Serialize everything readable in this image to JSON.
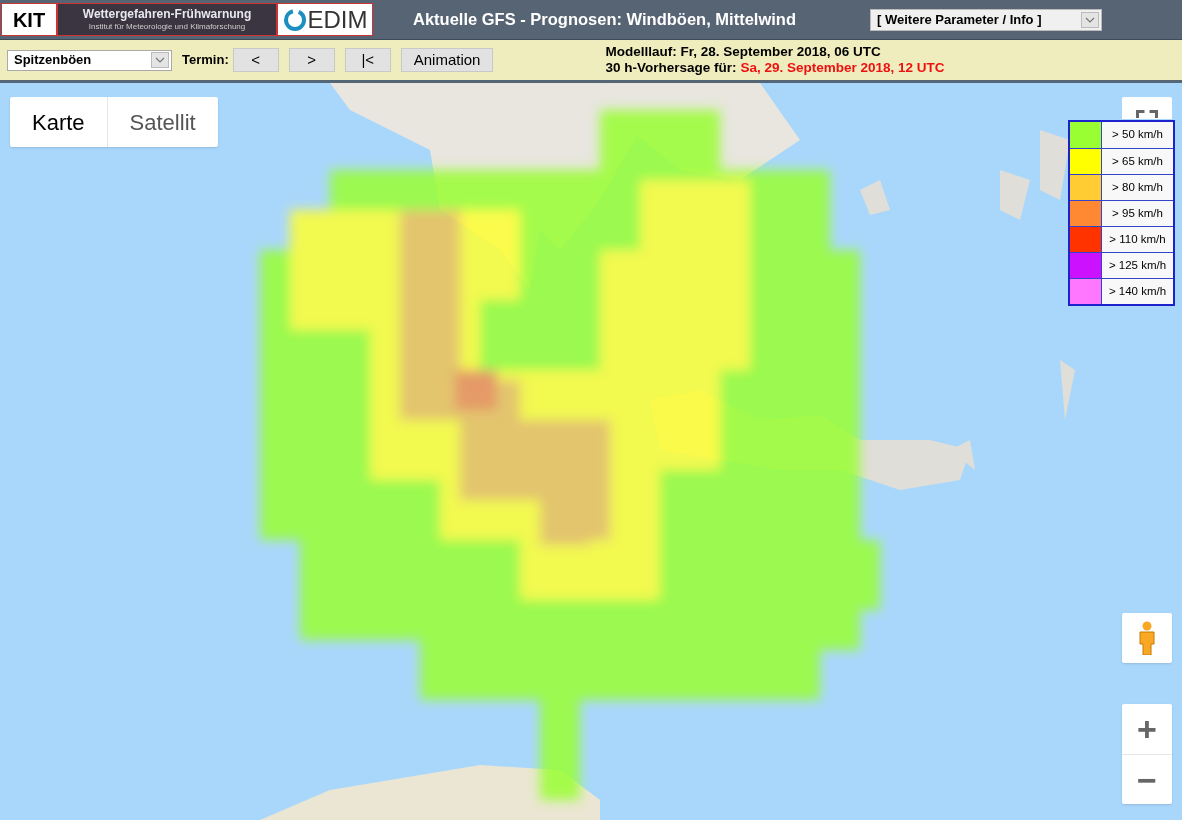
{
  "header": {
    "logo_kit": {
      "text": "KIT"
    },
    "banner": {
      "title": "Wettergefahren-Frühwarnung",
      "subtitle": "Institut für Meteorologie und Klimaforschung"
    },
    "logo_cedim": {
      "text": "EDIM"
    },
    "title": "Aktuelle GFS - Prognosen: Windböen, Mittelwind",
    "menu": {
      "value": "[ Weitere Parameter / Info ]"
    }
  },
  "toolbar": {
    "parameter": {
      "value": "Spitzenböen"
    },
    "termin_label": "Termin:",
    "buttons": [
      "<",
      ">",
      "|<",
      "Animation"
    ],
    "modelllauf": "Modelllauf: Fr, 28. September 2018, 06 UTC",
    "vorhersage_label": "30 h-Vorhersage für:",
    "vorhersage_time": "Sa, 29. September 2018, 12 UTC"
  },
  "map": {
    "map_type": [
      {
        "label": "Karte",
        "selected": true
      },
      {
        "label": "Satellit",
        "selected": false
      }
    ],
    "legend": [
      {
        "label": "> 50 km/h",
        "color": "#99ff33"
      },
      {
        "label": "> 65 km/h",
        "color": "#ffff00"
      },
      {
        "label": "> 80 km/h",
        "color": "#ffcc33"
      },
      {
        "label": "> 95 km/h",
        "color": "#ff8833"
      },
      {
        "label": "> 110 km/h",
        "color": "#ff3300"
      },
      {
        "label": "> 125 km/h",
        "color": "#cc11ff"
      },
      {
        "label": "> 140 km/h",
        "color": "#ff77ff"
      }
    ],
    "zoom": [
      "+",
      "−"
    ]
  }
}
